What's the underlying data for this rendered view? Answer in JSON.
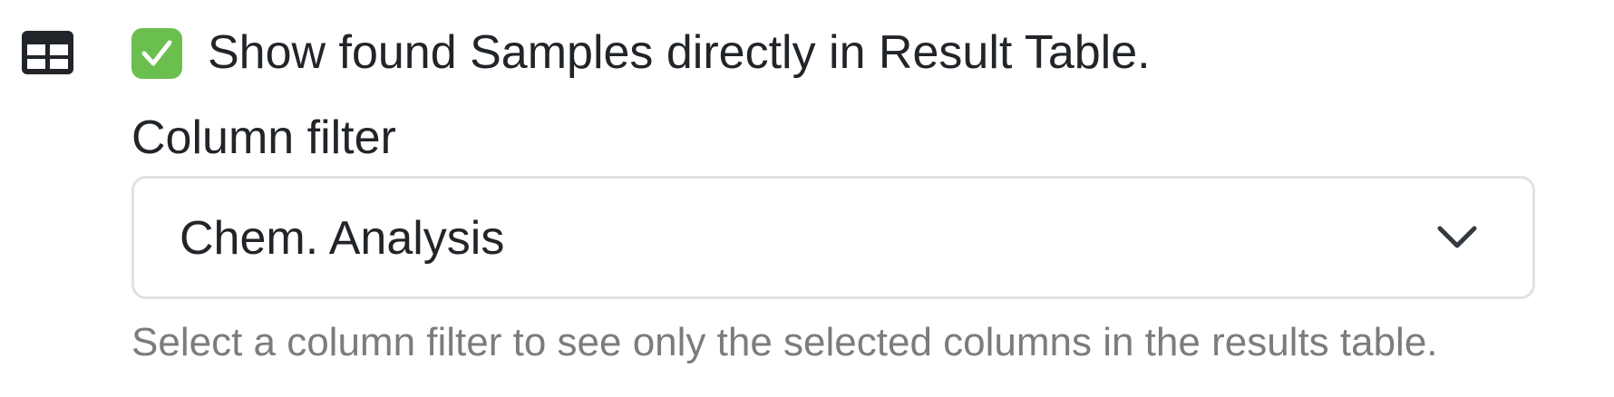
{
  "icons": {
    "table": "table-icon",
    "check": "checkmark-icon",
    "dropdown": "chevron-down-icon"
  },
  "colors": {
    "checkbox_checked": "#6bbf4e",
    "text": "#212529",
    "help_text": "#7c7c7c",
    "border": "#dee2e6"
  },
  "show_samples": {
    "checked": true,
    "label": "Show found Samples directly in Result Table."
  },
  "column_filter": {
    "label": "Column filter",
    "selected_value": "Chem. Analysis",
    "help_text": "Select a column filter to see only the selected columns in the results table."
  }
}
